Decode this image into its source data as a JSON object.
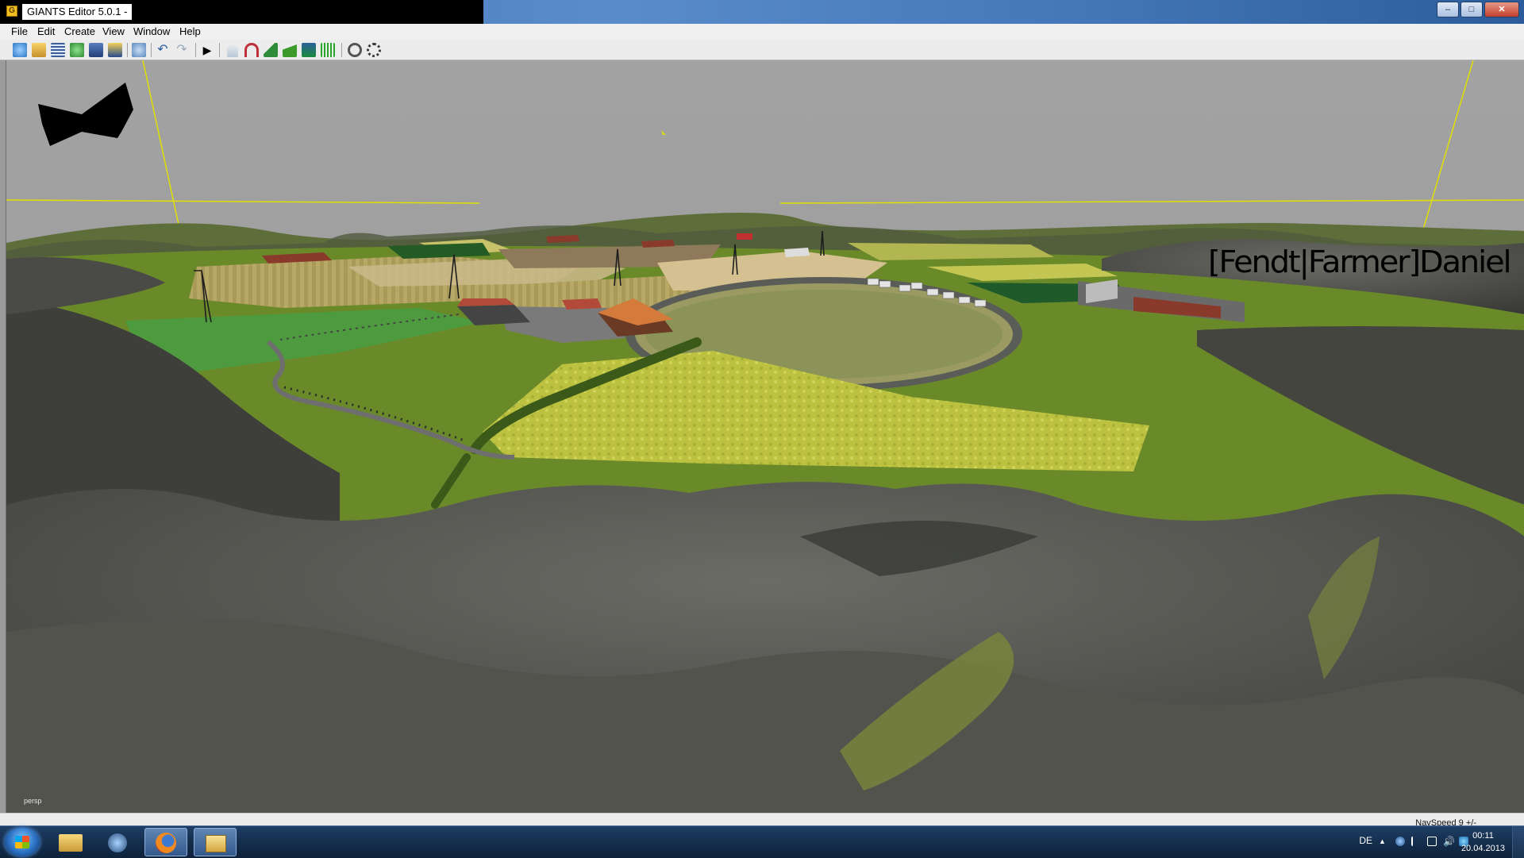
{
  "window": {
    "title": "GIANTS Editor 5.0.1 -",
    "controls": [
      "–",
      "□",
      "✕"
    ]
  },
  "menu": {
    "items": [
      "File",
      "Edit",
      "Create",
      "View",
      "Window",
      "Help"
    ]
  },
  "toolbar": {
    "icons": [
      "new-scene-icon",
      "open-icon",
      "list-icon",
      "refresh-icon",
      "save-icon",
      "save-as-icon",
      "import-icon",
      "undo-icon",
      "redo-icon",
      "play-icon",
      "house-icon",
      "arch-icon",
      "terrain-icon",
      "foliage-icon",
      "trees-icon",
      "grass-icon",
      "select-icon",
      "snap-icon"
    ]
  },
  "viewport": {
    "camera_label": "persp",
    "watermark": "[Fendt|Farmer]Daniel"
  },
  "statusbar": {
    "nav_speed": "NavSpeed 9 +/-"
  },
  "taskbar": {
    "language": "DE",
    "time": "00:11",
    "date": "20.04.2013",
    "pinned": [
      "windows-explorer-icon",
      "media-player-icon",
      "firefox-icon",
      "giants-editor-icon"
    ]
  },
  "colors": {
    "sky": "#9e9e9e",
    "grass": "#5f7b2c",
    "field_yellow": "#b9c040",
    "rock": "#4e4f4b",
    "taskbar": "#15304f",
    "titlebar": "#4a7ec0"
  }
}
